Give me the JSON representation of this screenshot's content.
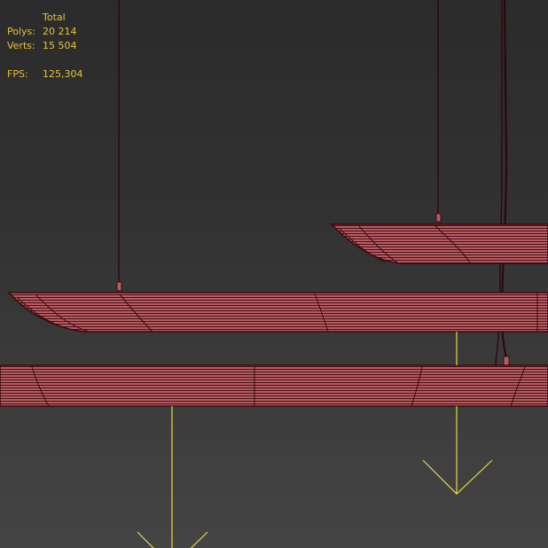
{
  "stats": {
    "header": "Total",
    "polys_label": "Polys:",
    "polys_value": "20 214",
    "verts_label": "Verts:",
    "verts_value": "15 504",
    "fps_label": "FPS:",
    "fps_value": "125,304"
  },
  "colors": {
    "stats_text": "#e6c13a",
    "mesh_fill": "#b45e62",
    "wire": "#3a0810",
    "light_helper": "#e8d84a"
  },
  "icons": {
    "light_arrow": "downward-arrow-icon"
  }
}
